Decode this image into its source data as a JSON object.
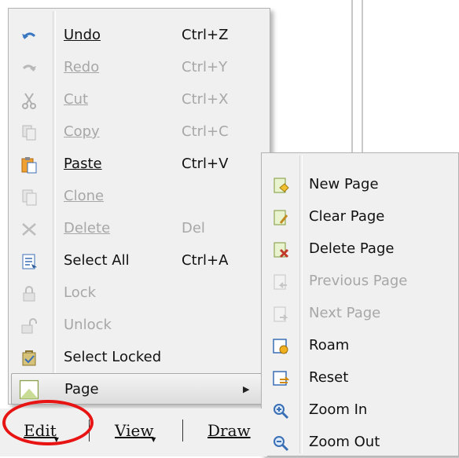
{
  "edit_menu": {
    "items": [
      {
        "label": "Undo",
        "shortcut": "Ctrl+Z",
        "icon": "undo-icon",
        "disabled": false
      },
      {
        "label": "Redo",
        "shortcut": "Ctrl+Y",
        "icon": "redo-icon",
        "disabled": true
      },
      {
        "label": "Cut",
        "shortcut": "Ctrl+X",
        "icon": "scissors-icon",
        "disabled": true
      },
      {
        "label": "Copy",
        "shortcut": "Ctrl+C",
        "icon": "copy-icon",
        "disabled": true
      },
      {
        "label": "Paste",
        "shortcut": "Ctrl+V",
        "icon": "paste-icon",
        "disabled": false
      },
      {
        "label": "Clone",
        "shortcut": "",
        "icon": "clone-icon",
        "disabled": true
      },
      {
        "label": "Delete",
        "shortcut": "Del",
        "icon": "delete-icon",
        "disabled": true
      },
      {
        "label": "Select All",
        "shortcut": "Ctrl+A",
        "icon": "select-all-icon",
        "disabled": false
      },
      {
        "label": "Lock",
        "shortcut": "",
        "icon": "lock-icon",
        "disabled": true
      },
      {
        "label": "Unlock",
        "shortcut": "",
        "icon": "unlock-icon",
        "disabled": true
      },
      {
        "label": "Select Locked",
        "shortcut": "",
        "icon": "select-locked-icon",
        "disabled": false
      },
      {
        "label": "Page",
        "shortcut": "",
        "icon": "page-icon",
        "disabled": false,
        "highlighted": true,
        "has_submenu": true
      }
    ]
  },
  "page_submenu": {
    "items": [
      {
        "label": "New Page",
        "icon": "new-page-icon",
        "disabled": false
      },
      {
        "label": "Clear Page",
        "icon": "clear-page-icon",
        "disabled": false
      },
      {
        "label": "Delete Page",
        "icon": "delete-page-icon",
        "disabled": false
      },
      {
        "label": "Previous Page",
        "icon": "previous-page-icon",
        "disabled": true
      },
      {
        "label": "Next Page",
        "icon": "next-page-icon",
        "disabled": true
      },
      {
        "label": "Roam",
        "icon": "roam-icon",
        "disabled": false
      },
      {
        "label": "Reset",
        "icon": "reset-icon",
        "disabled": false
      },
      {
        "label": "Zoom In",
        "icon": "zoom-in-icon",
        "disabled": false
      },
      {
        "label": "Zoom Out",
        "icon": "zoom-out-icon",
        "disabled": false
      }
    ]
  },
  "menubar": {
    "edit": "Edit",
    "view": "View",
    "draw": "Draw"
  },
  "colors": {
    "menu_bg": "#f0f0f0",
    "disabled_text": "#a7a7a7",
    "annotation_circle": "#e81313"
  }
}
